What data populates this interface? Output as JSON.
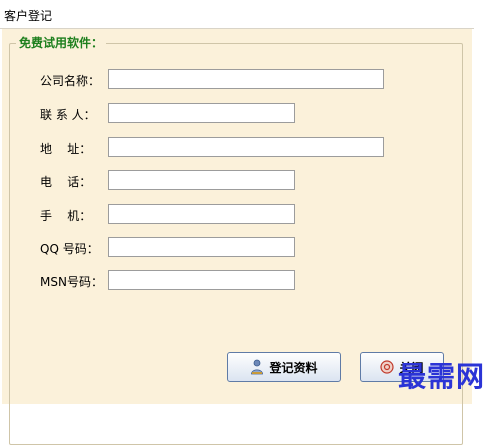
{
  "window": {
    "title": "客户登记"
  },
  "group": {
    "legend": "免费试用软件："
  },
  "form": {
    "fields": [
      {
        "label": "公司名称：",
        "value": "",
        "width": "wide"
      },
      {
        "label": "联 系 人：",
        "value": "",
        "width": "short"
      },
      {
        "label": "地    址：",
        "value": "",
        "width": "wide"
      },
      {
        "label": "电    话：",
        "value": "",
        "width": "short"
      },
      {
        "label": "手    机：",
        "value": "",
        "width": "short"
      },
      {
        "label": "QQ 号码：",
        "value": "",
        "width": "short"
      },
      {
        "label": "MSN号码：",
        "value": "",
        "width": "short"
      }
    ]
  },
  "buttons": {
    "register_label": "登记资料",
    "close_label": "关闭"
  },
  "watermark": {
    "text": "最需网"
  },
  "colors": {
    "panel_bg": "#fbf1da",
    "legend_green": "#1d7f1d",
    "watermark_blue": "#2b34d6"
  }
}
